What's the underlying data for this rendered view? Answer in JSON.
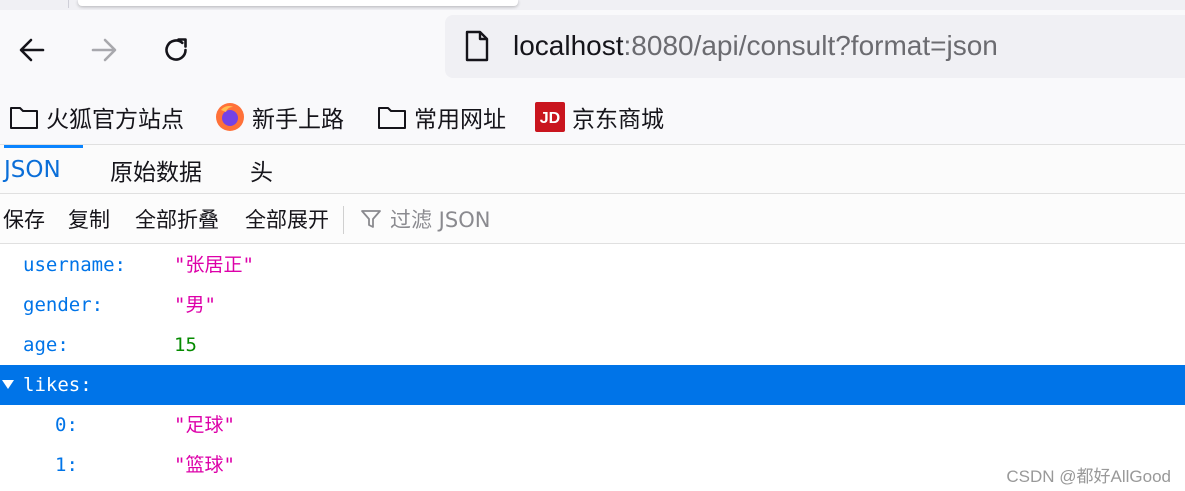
{
  "browser": {
    "url_host": "localhost",
    "url_rest": ":8080/api/consult?format=json",
    "nav_icons": [
      "back-arrow-icon",
      "forward-arrow-icon",
      "reload-icon"
    ]
  },
  "bookmarks": [
    {
      "label": "火狐官方站点",
      "icon": "folder-icon"
    },
    {
      "label": "新手上路",
      "icon": "firefox-icon"
    },
    {
      "label": "常用网址",
      "icon": "folder-icon"
    },
    {
      "label": "京东商城",
      "icon": "jd-icon",
      "icon_text": "JD"
    }
  ],
  "viewer_tabs": [
    "JSON",
    "原始数据",
    "头"
  ],
  "toolbar": {
    "save": "保存",
    "copy": "复制",
    "collapse_all": "全部折叠",
    "expand_all": "全部展开",
    "filter_placeholder": "过滤 JSON"
  },
  "json_tree": [
    {
      "key": "username:",
      "value": "\"张居正\"",
      "type": "string"
    },
    {
      "key": "gender:",
      "value": "\"男\"",
      "type": "string"
    },
    {
      "key": "age:",
      "value": "15",
      "type": "number"
    },
    {
      "key": "likes:",
      "value": "",
      "type": "array",
      "expanded": true,
      "selected": true
    },
    {
      "key": "0:",
      "value": "\"足球\"",
      "type": "string"
    },
    {
      "key": "1:",
      "value": "\"篮球\"",
      "type": "string"
    }
  ],
  "watermark": "CSDN @都好AllGood",
  "colors": {
    "accent": "#0074e8",
    "key": "#0074e8",
    "string": "#dd00a9",
    "number": "#058b00",
    "jd_red": "#c9151e"
  }
}
